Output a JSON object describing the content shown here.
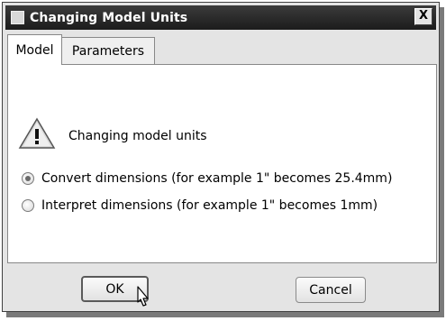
{
  "window": {
    "title": "Changing Model Units",
    "close_label": "X"
  },
  "tabs": [
    {
      "label": "Model",
      "active": true
    },
    {
      "label": "Parameters",
      "active": false
    }
  ],
  "message": {
    "icon": "warning-icon",
    "text": "Changing model units"
  },
  "options": [
    {
      "label": "Convert dimensions (for example 1\" becomes 25.4mm)",
      "checked": true
    },
    {
      "label": "Interpret dimensions (for example 1\" becomes 1mm)",
      "checked": false
    }
  ],
  "buttons": {
    "ok": "OK",
    "cancel": "Cancel"
  }
}
